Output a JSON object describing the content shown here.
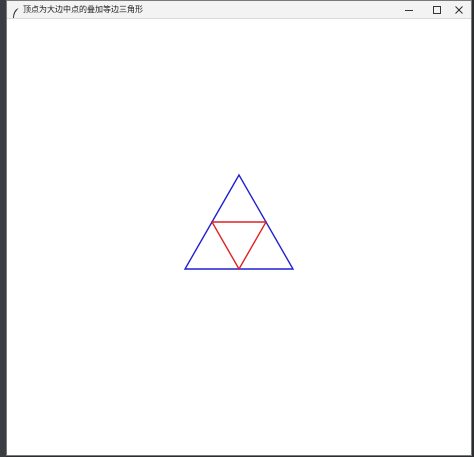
{
  "window": {
    "title": "顶点为大边中点的叠加等边三角形",
    "app_icon": "feather-icon",
    "controls": {
      "minimize_icon": "minimize-icon",
      "maximize_icon": "maximize-icon",
      "close_icon": "close-icon"
    }
  },
  "canvas": {
    "outer_triangle_color": "#2020d0",
    "inner_triangle_color": "#e02020",
    "background": "#ffffff"
  }
}
